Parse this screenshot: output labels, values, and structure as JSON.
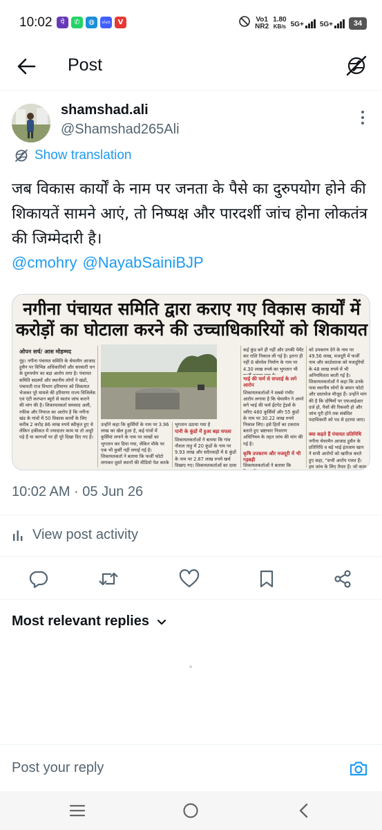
{
  "status_bar": {
    "time": "10:02",
    "app_icons": [
      {
        "name": "phonepe-icon",
        "glyph": "पे",
        "color": "#6739b7"
      },
      {
        "name": "whatsapp-icon",
        "glyph": "✆",
        "color": "#25d366"
      },
      {
        "name": "edge-icon",
        "glyph": "◍",
        "color": "#1b8fd8"
      },
      {
        "name": "vivo-icon",
        "glyph": "vivo",
        "color": "#415fff"
      },
      {
        "name": "vivo-video-icon",
        "glyph": "V",
        "color": "#e53935"
      }
    ],
    "volte": "Vo1",
    "network_type": "NR2",
    "speed": "1.80",
    "speed_unit": "KB/s",
    "sim1": "5G+",
    "sim2": "5G+",
    "battery": "34"
  },
  "header": {
    "title": "Post",
    "back_icon": "arrow-left-icon",
    "translate_icon": "translate-off-icon"
  },
  "post": {
    "display_name": "shamshad.ali",
    "handle": "@Shamshad265Ali",
    "show_translation": "Show translation",
    "text": "जब विकास कार्यों के नाम पर जनता के पैसे का दुरुपयोग होने की शिकायतें सामने आएं, तो निष्पक्ष और पारदर्शी जांच होना लोकतंत्र की जिम्मेदारी है।",
    "mentions": [
      "@cmohry",
      "@NayabSainiBJP"
    ],
    "timestamp": "10:02 AM · 05 Jun 26",
    "view_activity": "View post activity"
  },
  "news_image": {
    "headline_line1": "नगीना पंचायत समिति द्वारा कराए गए विकास कार्यों में",
    "headline_line2": "करोड़ों का घोटाला करने की उच्चाधिकारियों को शिकायत",
    "byline": "ओपन सर्च/ आस मोहम्मद",
    "col1": "नूंह। नगीना पंचायत समिति के चेयरमैन आजाद हुसैन पर विभिन्न अधिकारियों और सरकारी धन के दुरुपयोग का बड़ा आरोप लगा है। पंचायत समिति सदस्यों और स्थानीय लोगों ने खंडों, पंचायती राज विभाग हरियाणा को शिकायत भेजकर पूरे मामले की हरियाणा राज्य विजिलेंस एवं एंटी करप्शन ब्यूरो से स्वतंत्र जांच कराने की मांग की है। शिकायतकर्ता समसाद अली, रफीक और नियाज का आरोप है कि नगीना खंड के गांवों में 50 विकास कार्यों के लिए करीब 2 करोड़ 86 लाख रुपये स्वीकृत हुए थे लेकिन हकीकत में ज्यादातर काम या तो अधूरे पड़े हैं या कागजों पर ही पूरे दिखा दिए गए हैं।",
    "col2": "उन्होंने कहा कि कुर्सियों के नाम पर 3.96 लाख का खेल हुआ है, कई गांवों में कुर्सियां लगाने के नाम पर लाखों का भुगतान कर दिया गया, लेकिन मौके पर एक भी कुर्सी नहीं लगाई गई है। शिकायतकर्ता ने बताया कि फर्जी फोटो लगाकर दूसरे स्थानों की वीडियो पेश करके",
    "col3_top": "भुगतान उठाया गया है",
    "col3_subhead": "पानी के कुंडों में हुआ बड़ा घपला",
    "col3": "शिकायतकर्ताओं ने बताया कि गांव नौशल ताड़ु में 20 कुंडों के नाम पर 9.93 लाख और सदैनवाड़ी में 6 कुंडों के नाम पर 2.87 लाख रुपये खर्च दिखाए गए। शिकायतकर्ताओं का दावा है कि",
    "col4_top": "कई कुंड बने ही नहीं और उनकी पेमेंट कर राशि निकाल ली गई है। इतना ही नहीं 8 बोरवेल निर्माण के नाम पर 4.30 लाख रुपये का भुगतान भी फर्जी बताया गया है।",
    "col4_subhead": "भाई की फर्म से सप्लाई के लगे आरोप",
    "col4": "शिकायतकर्ताओं ने सबसे गंभीर आरोप लगाया है कि चेयरमैन ने अपने सगे भाई की फर्म ईंटगेट ट्रेडर्स के जरिए 480 कुर्सियों और 55 कुंडों के नाम पर 30.22 लाख रुपये निकाल लिए। इसे हितों का टकराव बताते हुए भ्रष्टाचार निवारण अधिनियम के तहत जांच की मांग की गई है।",
    "col4_subhead2": "कृषि उपकरण और मजदूरी में भी गड़बड़ी",
    "col4_bottom": "शिकायतकर्ताओं ने बताया कि किसानों",
    "col5": "को उपकरण देने के नाम पर 49.56 लाख, मजदूरी में फर्जी नाम और कार्डधारक को मजदूरियों के 48 लाख रुपये में भी अनियमितता बरती गई है। शिकायतकर्ताओं ने कहा कि उनके पास स्थानीय लोगों के बयान फोटो और दस्तावेज मौजूद हैं। उन्होंने मांग की है कि दोषियों पर एफआईआर दर्ज हो, पैसों की रिकवरी हो और जांच पूरी होने तक संबंधित पदाधिकारी को पद से हटाया जाए।",
    "col5_subhead": "क्या कहते हैं पंचायत प्रतिनिधि",
    "col5_bottom": "नगीना चेयरमैन आजाद हुसैन के प्रतिनिधि व बड़े भाई इंतजाम खान ने सभी आरोपों को खारिज करते हुए कहा, \"सभी आरोप गलत हैं। हम जांच के लिए तैयार हैं। जो काम हुए हैं, उन्हीं की नियमों के तहत पेमेंट हुई है।\""
  },
  "actions": [
    {
      "name": "reply-button",
      "icon": "reply-icon"
    },
    {
      "name": "repost-button",
      "icon": "repost-icon"
    },
    {
      "name": "like-button",
      "icon": "heart-icon"
    },
    {
      "name": "bookmark-button",
      "icon": "bookmark-icon"
    },
    {
      "name": "share-button",
      "icon": "share-icon"
    }
  ],
  "replies": {
    "sort_label": "Most relevant replies"
  },
  "reply_bar": {
    "placeholder": "Post your reply",
    "camera_icon": "camera-icon"
  },
  "nav_bar": {
    "recents_icon": "recents-icon",
    "home_icon": "home-icon",
    "back_icon": "back-icon"
  },
  "colors": {
    "accent": "#1d9bf0",
    "secondary_text": "#536471",
    "primary_text": "#0f1419",
    "headline_red": "#c0282e"
  }
}
